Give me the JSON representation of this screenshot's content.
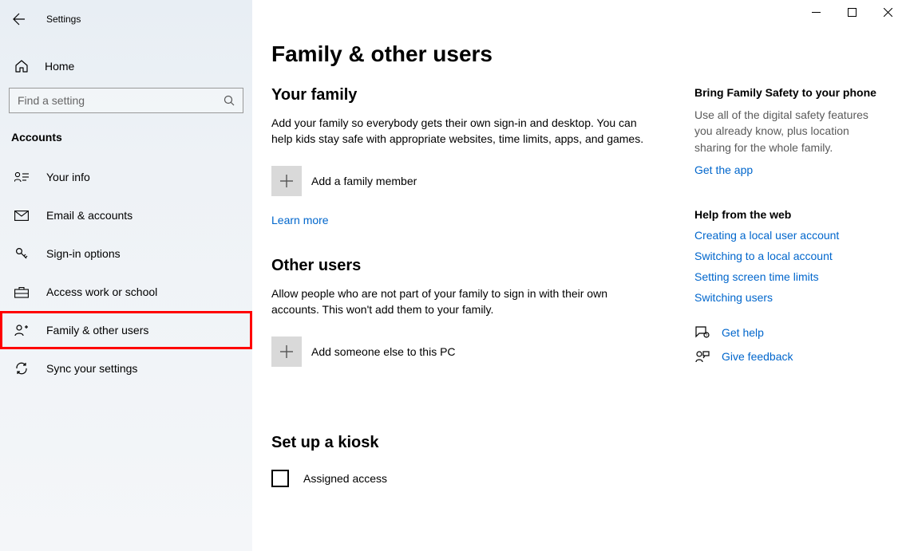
{
  "app": {
    "title": "Settings"
  },
  "sidebar": {
    "home": "Home",
    "search_placeholder": "Find a setting",
    "section": "Accounts",
    "items": [
      {
        "label": "Your info"
      },
      {
        "label": "Email & accounts"
      },
      {
        "label": "Sign-in options"
      },
      {
        "label": "Access work or school"
      },
      {
        "label": "Family & other users"
      },
      {
        "label": "Sync your settings"
      }
    ]
  },
  "page": {
    "title": "Family & other users",
    "family": {
      "heading": "Your family",
      "desc": "Add your family so everybody gets their own sign-in and desktop. You can help kids stay safe with appropriate websites, time limits, apps, and games.",
      "add_label": "Add a family member",
      "learn_more": "Learn more"
    },
    "others": {
      "heading": "Other users",
      "desc": "Allow people who are not part of your family to sign in with their own accounts. This won't add them to your family.",
      "add_label": "Add someone else to this PC"
    },
    "kiosk": {
      "heading": "Set up a kiosk",
      "assigned": "Assigned access"
    }
  },
  "right": {
    "safety": {
      "heading": "Bring Family Safety to your phone",
      "desc": "Use all of the digital safety features you already know, plus location sharing for the whole family.",
      "link": "Get the app"
    },
    "help": {
      "heading": "Help from the web",
      "links": [
        "Creating a local user account",
        "Switching to a local account",
        "Setting screen time limits",
        "Switching users"
      ]
    },
    "actions": {
      "get_help": "Get help",
      "feedback": "Give feedback"
    }
  }
}
